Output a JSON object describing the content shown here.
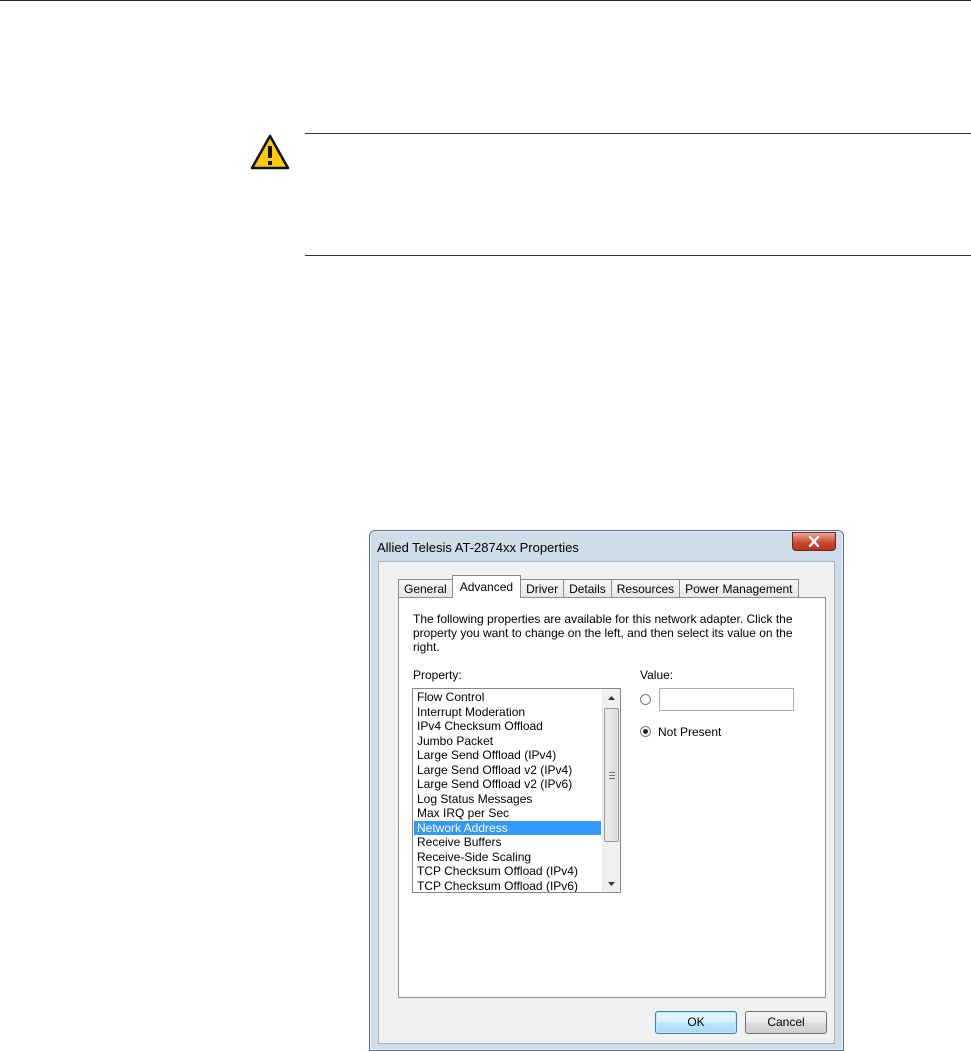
{
  "dialog": {
    "title": "Allied Telesis AT-2874xx Properties",
    "tabs": [
      {
        "label": "General",
        "active": false
      },
      {
        "label": "Advanced",
        "active": true
      },
      {
        "label": "Driver",
        "active": false
      },
      {
        "label": "Details",
        "active": false
      },
      {
        "label": "Resources",
        "active": false
      },
      {
        "label": "Power Management",
        "active": false
      }
    ],
    "description": "The following properties are available for this network adapter. Click the property you want to change on the left, and then select its value on the right.",
    "property_label": "Property:",
    "value_label": "Value:",
    "properties": [
      "Flow Control",
      "Interrupt Moderation",
      "IPv4 Checksum Offload",
      "Jumbo Packet",
      "Large Send Offload (IPv4)",
      "Large Send Offload v2 (IPv4)",
      "Large Send Offload v2 (IPv6)",
      "Log Status Messages",
      "Max IRQ per Sec",
      "Network Address",
      "Receive Buffers",
      "Receive-Side Scaling",
      "TCP Checksum Offload (IPv4)",
      "TCP Checksum Offload (IPv6)"
    ],
    "selected_property": "Network Address",
    "value_input": "",
    "not_present_label": "Not Present",
    "not_present_selected": true,
    "ok_label": "OK",
    "cancel_label": "Cancel"
  },
  "icons": {
    "caution": "warning-triangle-icon",
    "close": "close-icon",
    "scroll_up": "scroll-up-arrow-icon",
    "scroll_down": "scroll-down-arrow-icon"
  },
  "colors": {
    "selection": "#3399ff",
    "warning_fill": "#ffcc00",
    "close_button": "#c94a33"
  }
}
